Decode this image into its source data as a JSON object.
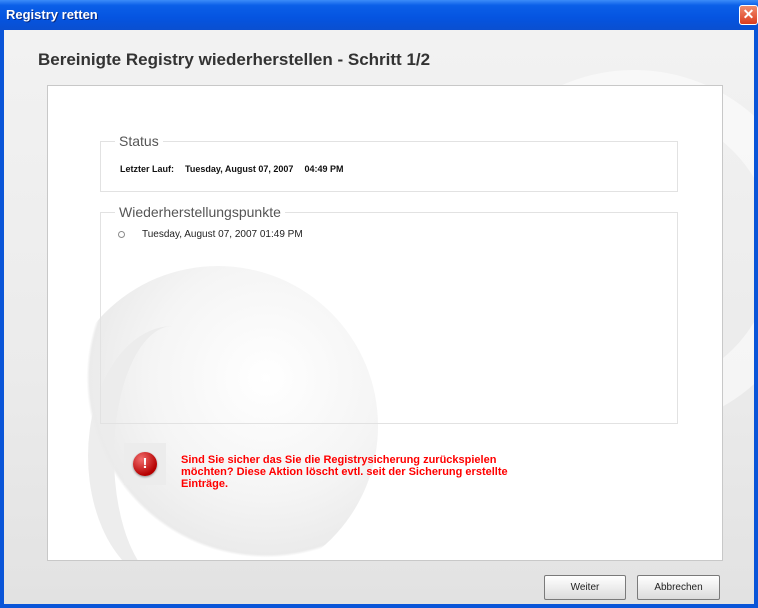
{
  "window": {
    "title": "Registry retten",
    "close_label": "✕"
  },
  "heading": "Bereinigte Registry wiederherstellen - Schritt 1/2",
  "status": {
    "legend": "Status",
    "last_run_label": "Letzter Lauf:",
    "last_run_date": "Tuesday, August 07, 2007",
    "last_run_time": "04:49 PM"
  },
  "restore_points": {
    "legend": "Wiederherstellungspunkte",
    "items": [
      {
        "label": "Tuesday, August 07, 2007 01:49 PM",
        "selected": false
      }
    ]
  },
  "warning": {
    "icon": "exclamation-icon",
    "lines": [
      "Sind Sie sicher das Sie die Registrysicherung zurückspielen",
      "möchten? Diese Aktion löscht evtl. seit der Sicherung erstellte",
      "Einträge."
    ],
    "color": "#ff0000"
  },
  "buttons": {
    "next": "Weiter",
    "cancel": "Abbrechen"
  }
}
